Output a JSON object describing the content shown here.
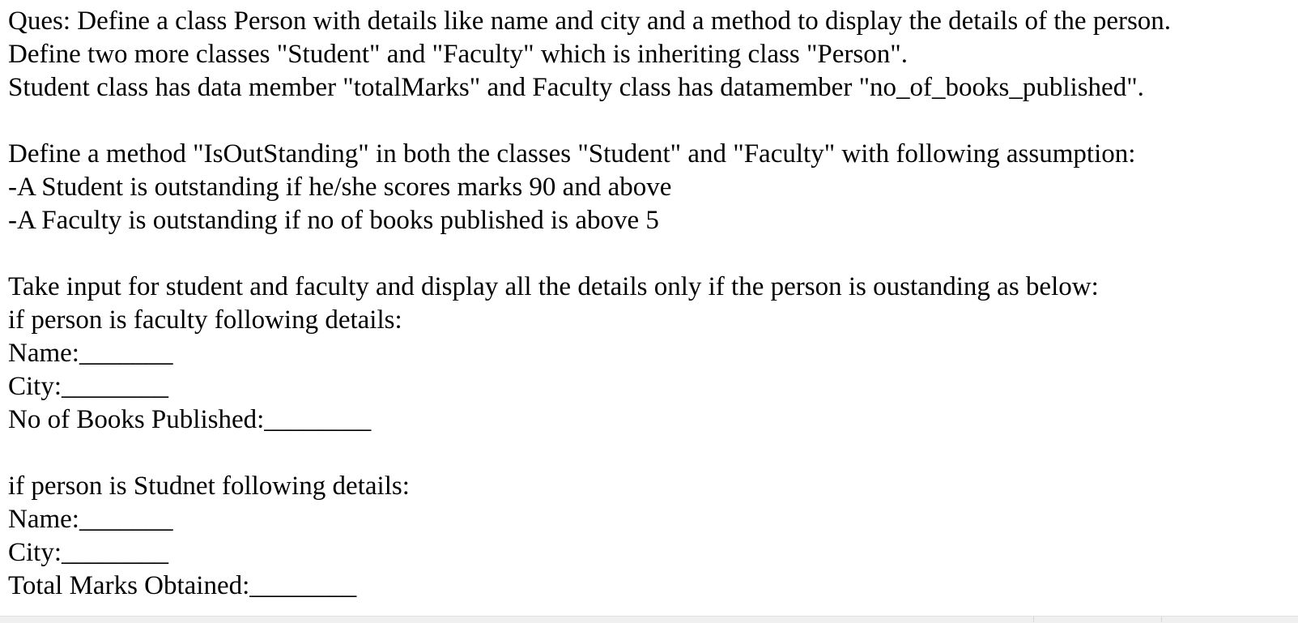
{
  "document": {
    "lines": [
      "Ques: Define a class Person with details like name and city and a method to display the details of the person.",
      "Define two more classes \"Student\" and \"Faculty\" which is inheriting class \"Person\".",
      "Student class has data member \"totalMarks\" and Faculty class has datamember \"no_of_books_published\".",
      "",
      "Define a method \"IsOutStanding\" in both the classes \"Student\" and \"Faculty\" with following assumption:",
      "-A Student is outstanding if he/she scores marks 90 and above",
      "-A Faculty is outstanding if no of books published is above 5",
      "",
      "Take input for student and faculty and display all the details only if the person is oustanding as below:",
      "if person is faculty following details:",
      "Name:_______",
      "City:________",
      "No of Books Published:________",
      "",
      "if person is Studnet following details:",
      "Name:_______",
      "City:________",
      "Total Marks Obtained:________"
    ]
  },
  "colors": {
    "text": "#000000",
    "background": "#ffffff",
    "footer_strip": "#f0f0f0"
  }
}
